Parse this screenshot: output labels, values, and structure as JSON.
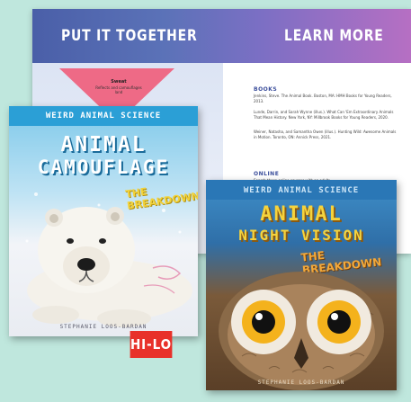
{
  "spread": {
    "left_heading": "PUT IT TOGETHER",
    "right_heading": "LEARN MORE",
    "funnel_title": "Sweat",
    "funnel_text": "Reflects and camouflages land",
    "books_heading": "BOOKS",
    "ref1": "Jenkins, Steve. The Animal Book. Boston, MA: HMH Books for Young Readers, 2013.",
    "ref2": "Lunde, Darrin, and Sarah Wynne (illus.). What Can 'Em Extraordinary Animals That Mean History. New York, NY: Millbrook Books for Young Readers, 2020.",
    "ref3": "Weiner, Natasha, and Samantha Owen (illus.). Hunting Wild: Awesome Animals in Motion. Toronto, ON: Annick Press, 2021.",
    "online_heading": "ONLINE",
    "ref4": "Search these online sources with an adult:"
  },
  "book1": {
    "series": "WEIRD ANIMAL SCIENCE",
    "title_line1": "ANIMAL",
    "title_line2": "CAMOUFLAGE",
    "subtitle": "THE BREAKDOWN",
    "author": "STEPHANIE LOOS-BARDAN"
  },
  "book2": {
    "series": "WEIRD ANIMAL SCIENCE",
    "title_line1": "ANIMAL",
    "title_line2": "NIGHT VISION",
    "subtitle": "THE BREAKDOWN",
    "author": "STEPHANIE LOOS-BARDAN"
  },
  "badge": {
    "label": "HI-LO"
  },
  "colors": {
    "background": "#bfe7dd",
    "badge": "#e8312a",
    "camo_accent": "#2b9fd6",
    "night_title": "#f6d33c"
  }
}
